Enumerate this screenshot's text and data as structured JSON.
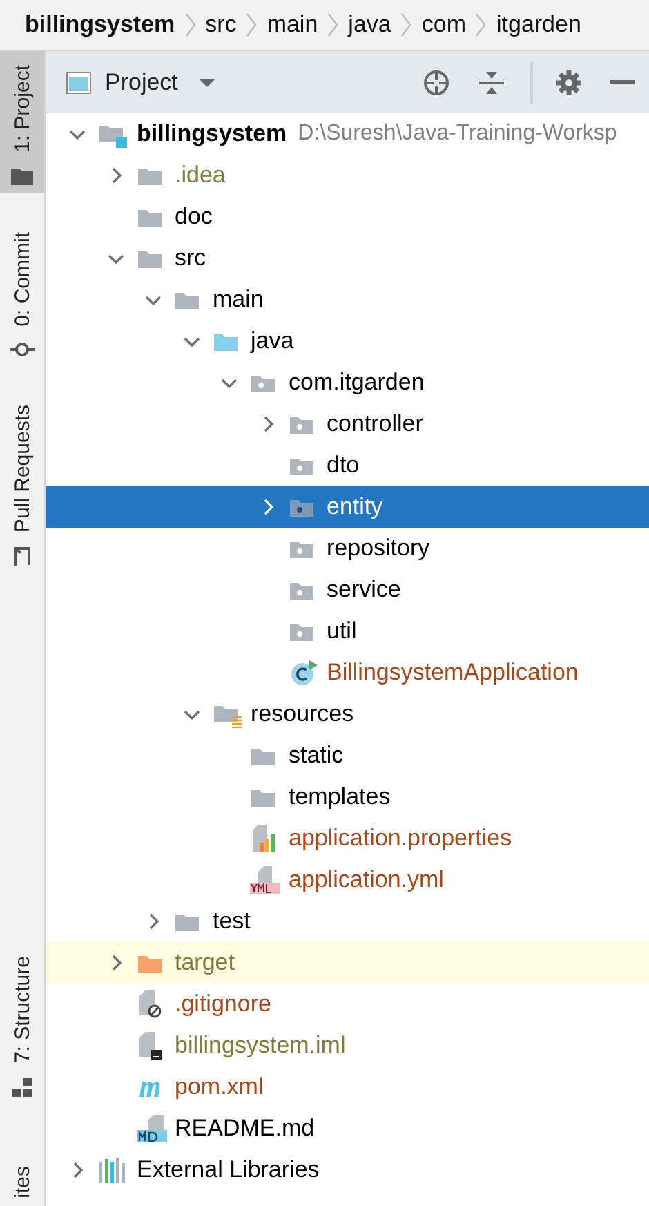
{
  "breadcrumbs": [
    {
      "label": "billingsystem",
      "bold": true
    },
    {
      "label": "src",
      "bold": false
    },
    {
      "label": "main",
      "bold": false
    },
    {
      "label": "java",
      "bold": false
    },
    {
      "label": "com",
      "bold": false
    },
    {
      "label": "itgarden",
      "bold": false
    }
  ],
  "tool_tabs_top": [
    {
      "label": "1: Project",
      "kind": "folder",
      "selected": true
    },
    {
      "label": "0: Commit",
      "kind": "commit",
      "selected": false
    },
    {
      "label": "Pull Requests",
      "kind": "pull",
      "selected": false
    }
  ],
  "tool_tabs_bottom": [
    {
      "label": "7: Structure",
      "kind": "structure",
      "selected": false
    },
    {
      "label": "ites",
      "kind": "plain",
      "selected": false
    }
  ],
  "panel": {
    "title": "Project"
  },
  "tree": [
    {
      "label": "billingsystem",
      "path": "D:\\Suresh\\Java-Training-Worksp",
      "kind": "module",
      "expandable": true,
      "color": "#000000",
      "bold": true,
      "selected": false,
      "highlighted": false,
      "children": [
        {
          "label": ".idea",
          "kind": "folder",
          "expandable": true,
          "color": "#7f7d3d",
          "bold": false,
          "selected": false,
          "highlighted": false
        },
        {
          "label": "doc",
          "kind": "folder",
          "expandable": false,
          "color": "#000000",
          "bold": false,
          "selected": false,
          "highlighted": false
        },
        {
          "label": "src",
          "kind": "folder",
          "expandable": true,
          "color": "#000000",
          "bold": false,
          "selected": false,
          "highlighted": false,
          "children": [
            {
              "label": "main",
              "kind": "folder",
              "expandable": true,
              "color": "#000000",
              "bold": false,
              "selected": false,
              "highlighted": false,
              "children": [
                {
                  "label": "java",
                  "kind": "source",
                  "expandable": true,
                  "color": "#000000",
                  "bold": false,
                  "selected": false,
                  "highlighted": false,
                  "children": [
                    {
                      "label": "com.itgarden",
                      "kind": "package",
                      "expandable": true,
                      "color": "#000000",
                      "bold": false,
                      "selected": false,
                      "highlighted": false,
                      "children": [
                        {
                          "label": "controller",
                          "kind": "package",
                          "expandable": true,
                          "color": "#000000",
                          "bold": false,
                          "selected": false,
                          "highlighted": false
                        },
                        {
                          "label": "dto",
                          "kind": "package",
                          "expandable": false,
                          "color": "#000000",
                          "bold": false,
                          "selected": false,
                          "highlighted": false
                        },
                        {
                          "label": "entity",
                          "kind": "package",
                          "expandable": true,
                          "color": "#ffffff",
                          "bold": false,
                          "selected": true,
                          "highlighted": false
                        },
                        {
                          "label": "repository",
                          "kind": "package",
                          "expandable": false,
                          "color": "#000000",
                          "bold": false,
                          "selected": false,
                          "highlighted": false
                        },
                        {
                          "label": "service",
                          "kind": "package",
                          "expandable": false,
                          "color": "#000000",
                          "bold": false,
                          "selected": false,
                          "highlighted": false
                        },
                        {
                          "label": "util",
                          "kind": "package",
                          "expandable": false,
                          "color": "#000000",
                          "bold": false,
                          "selected": false,
                          "highlighted": false
                        },
                        {
                          "label": "BillingsystemApplication",
                          "kind": "spring-class",
                          "expandable": false,
                          "color": "#a5491a",
                          "bold": false,
                          "selected": false,
                          "highlighted": false
                        }
                      ]
                    }
                  ]
                },
                {
                  "label": "resources",
                  "kind": "resources",
                  "expandable": true,
                  "color": "#000000",
                  "bold": false,
                  "selected": false,
                  "highlighted": false,
                  "children": [
                    {
                      "label": "static",
                      "kind": "folder",
                      "expandable": false,
                      "color": "#000000",
                      "bold": false,
                      "selected": false,
                      "highlighted": false
                    },
                    {
                      "label": "templates",
                      "kind": "folder",
                      "expandable": false,
                      "color": "#000000",
                      "bold": false,
                      "selected": false,
                      "highlighted": false
                    },
                    {
                      "label": "application.properties",
                      "kind": "properties",
                      "expandable": false,
                      "color": "#a5491a",
                      "bold": false,
                      "selected": false,
                      "highlighted": false
                    },
                    {
                      "label": "application.yml",
                      "kind": "yml",
                      "expandable": false,
                      "color": "#a5491a",
                      "bold": false,
                      "selected": false,
                      "highlighted": false
                    }
                  ]
                }
              ]
            },
            {
              "label": "test",
              "kind": "folder",
              "expandable": true,
              "color": "#000000",
              "bold": false,
              "selected": false,
              "highlighted": false
            }
          ]
        },
        {
          "label": "target",
          "kind": "excluded",
          "expandable": true,
          "color": "#7f7d3d",
          "bold": false,
          "selected": false,
          "highlighted": true
        },
        {
          "label": ".gitignore",
          "kind": "gitignore",
          "expandable": false,
          "color": "#a5491a",
          "bold": false,
          "selected": false,
          "highlighted": false
        },
        {
          "label": "billingsystem.iml",
          "kind": "iml",
          "expandable": false,
          "color": "#7f7d3d",
          "bold": false,
          "selected": false,
          "highlighted": false
        },
        {
          "label": "pom.xml",
          "kind": "maven",
          "expandable": false,
          "color": "#a5491a",
          "bold": false,
          "selected": false,
          "highlighted": false
        },
        {
          "label": "README.md",
          "kind": "markdown",
          "expandable": false,
          "color": "#000000",
          "bold": false,
          "selected": false,
          "highlighted": false
        }
      ]
    },
    {
      "label": "External Libraries",
      "kind": "libraries",
      "expandable": true,
      "color": "#000000",
      "bold": false,
      "selected": false,
      "highlighted": false
    }
  ]
}
